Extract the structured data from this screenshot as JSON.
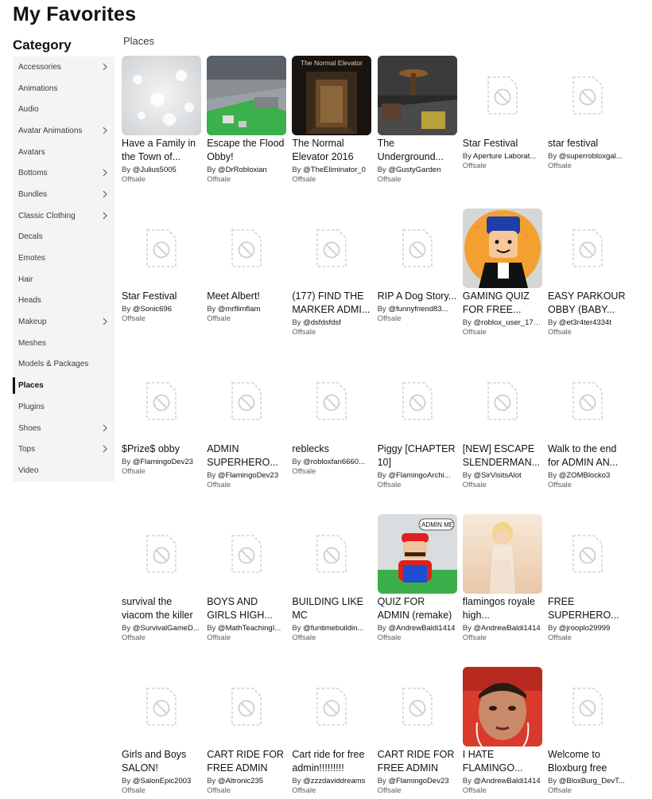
{
  "page": {
    "title": "My Favorites",
    "category_heading": "Category",
    "section_label": "Places"
  },
  "sidebar": {
    "items": [
      {
        "label": "Accessories",
        "chevron": true,
        "active": false
      },
      {
        "label": "Animations",
        "chevron": false,
        "active": false
      },
      {
        "label": "Audio",
        "chevron": false,
        "active": false
      },
      {
        "label": "Avatar Animations",
        "chevron": true,
        "active": false
      },
      {
        "label": "Avatars",
        "chevron": false,
        "active": false
      },
      {
        "label": "Bottoms",
        "chevron": true,
        "active": false
      },
      {
        "label": "Bundles",
        "chevron": true,
        "active": false
      },
      {
        "label": "Classic Clothing",
        "chevron": true,
        "active": false
      },
      {
        "label": "Decals",
        "chevron": false,
        "active": false
      },
      {
        "label": "Emotes",
        "chevron": false,
        "active": false
      },
      {
        "label": "Hair",
        "chevron": false,
        "active": false
      },
      {
        "label": "Heads",
        "chevron": false,
        "active": false
      },
      {
        "label": "Makeup",
        "chevron": true,
        "active": false
      },
      {
        "label": "Meshes",
        "chevron": false,
        "active": false
      },
      {
        "label": "Models & Packages",
        "chevron": false,
        "active": false
      },
      {
        "label": "Places",
        "chevron": false,
        "active": true
      },
      {
        "label": "Plugins",
        "chevron": false,
        "active": false
      },
      {
        "label": "Shoes",
        "chevron": true,
        "active": false
      },
      {
        "label": "Tops",
        "chevron": true,
        "active": false
      },
      {
        "label": "Video",
        "chevron": false,
        "active": false
      }
    ]
  },
  "items": [
    {
      "title": "Have a Family in the Town of...",
      "by": "By",
      "creator": "@Julius5005",
      "price": "Offsale",
      "thumb": "snow"
    },
    {
      "title": "Escape the Flood Obby!",
      "by": "By",
      "creator": "@DrRobloxian",
      "price": "Offsale",
      "thumb": "flood"
    },
    {
      "title": "The Normal Elevator 2016",
      "by": "By",
      "creator": "@TheEliminator_0",
      "price": "Offsale",
      "thumb": "elevator",
      "thumb_text": "The Normal Elevator"
    },
    {
      "title": "The Underground...",
      "by": "By",
      "creator": "@GustyGarden",
      "price": "Offsale",
      "thumb": "underground"
    },
    {
      "title": "Star Festival",
      "by": "By",
      "creator": "Aperture Laborat...",
      "price": "Offsale",
      "thumb": "placeholder"
    },
    {
      "title": "star festival",
      "by": "By",
      "creator": "@superrobloxgal...",
      "price": "Offsale",
      "thumb": "placeholder"
    },
    {
      "title": "Star Festival",
      "by": "By",
      "creator": "@Sonic696",
      "price": "Offsale",
      "thumb": "placeholder"
    },
    {
      "title": "Meet Albert!",
      "by": "By",
      "creator": "@mrflimflam",
      "price": "Offsale",
      "thumb": "placeholder"
    },
    {
      "title": "(177) FIND THE MARKER ADMI...",
      "by": "By",
      "creator": "@dsfdsfdsf",
      "price": "Offsale",
      "thumb": "placeholder"
    },
    {
      "title": "RIP A Dog Story...",
      "by": "By",
      "creator": "@funnyfriend83...",
      "price": "Offsale",
      "thumb": "placeholder"
    },
    {
      "title": "GAMING QUIZ FOR FREE...",
      "by": "By",
      "creator": "@roblox_user_171...",
      "price": "Offsale",
      "thumb": "avatar"
    },
    {
      "title": "EASY PARKOUR OBBY (BABY...",
      "by": "By",
      "creator": "@et3r4ter4334t",
      "price": "Offsale",
      "thumb": "placeholder"
    },
    {
      "title": "$Prize$ obby",
      "by": "By",
      "creator": "@FlamingoDev23",
      "price": "Offsale",
      "thumb": "placeholder"
    },
    {
      "title": "ADMIN SUPERHERO...",
      "by": "By",
      "creator": "@FlamingoDev23",
      "price": "Offsale",
      "thumb": "placeholder"
    },
    {
      "title": "reblecks",
      "by": "By",
      "creator": "@robloxfan6660...",
      "price": "Offsale",
      "thumb": "placeholder"
    },
    {
      "title": "Piggy [CHAPTER 10]",
      "by": "By",
      "creator": "@FlamingoArchi...",
      "price": "Offsale",
      "thumb": "placeholder"
    },
    {
      "title": "[NEW] ESCAPE SLENDERMAN...",
      "by": "By",
      "creator": "@SirVisitsAlot",
      "price": "Offsale",
      "thumb": "placeholder"
    },
    {
      "title": "Walk to the end for ADMIN AN...",
      "by": "By",
      "creator": "@ZOMBlocko3",
      "price": "Offsale",
      "thumb": "placeholder"
    },
    {
      "title": "survival the viacom the killer",
      "by": "By",
      "creator": "@SurvivalGameD...",
      "price": "Offsale",
      "thumb": "placeholder"
    },
    {
      "title": "BOYS AND GIRLS HIGH...",
      "by": "By",
      "creator": "@MathTeachingI...",
      "price": "Offsale",
      "thumb": "placeholder"
    },
    {
      "title": "BUILDING LIKE MC",
      "by": "By",
      "creator": "@funtimebuildin...",
      "price": "Offsale",
      "thumb": "placeholder"
    },
    {
      "title": "QUIZ FOR ADMIN (remake)",
      "by": "By",
      "creator": "@AndrewBaldi1414",
      "price": "Offsale",
      "thumb": "mario",
      "thumb_text": ":ADMIN ME"
    },
    {
      "title": "flamingos royale high...",
      "by": "By",
      "creator": "@AndrewBaldi1414",
      "price": "Offsale",
      "thumb": "royale"
    },
    {
      "title": "FREE SUPERHERO...",
      "by": "By",
      "creator": "@jrooplo29999",
      "price": "Offsale",
      "thumb": "placeholder"
    },
    {
      "title": "Girls and Boys SALON!",
      "by": "By",
      "creator": "@SalonEpic2003",
      "price": "Offsale",
      "thumb": "placeholder"
    },
    {
      "title": "CART RIDE FOR FREE ADMIN",
      "by": "By",
      "creator": "@Altronic235",
      "price": "Offsale",
      "thumb": "placeholder"
    },
    {
      "title": "Cart ride for free admin!!!!!!!!!",
      "by": "By",
      "creator": "@zzzdaviddreams",
      "price": "Offsale",
      "thumb": "placeholder"
    },
    {
      "title": "CART RIDE FOR FREE ADMIN",
      "by": "By",
      "creator": "@FlamingoDev23",
      "price": "Offsale",
      "thumb": "placeholder"
    },
    {
      "title": "I HATE FLAMINGO...",
      "by": "By",
      "creator": "@AndrewBaldi1414",
      "price": "Offsale",
      "thumb": "face"
    },
    {
      "title": "Welcome to Bloxburg free",
      "by": "By",
      "creator": "@BloxBurg_DevT...",
      "price": "Offsale",
      "thumb": "placeholder"
    }
  ]
}
